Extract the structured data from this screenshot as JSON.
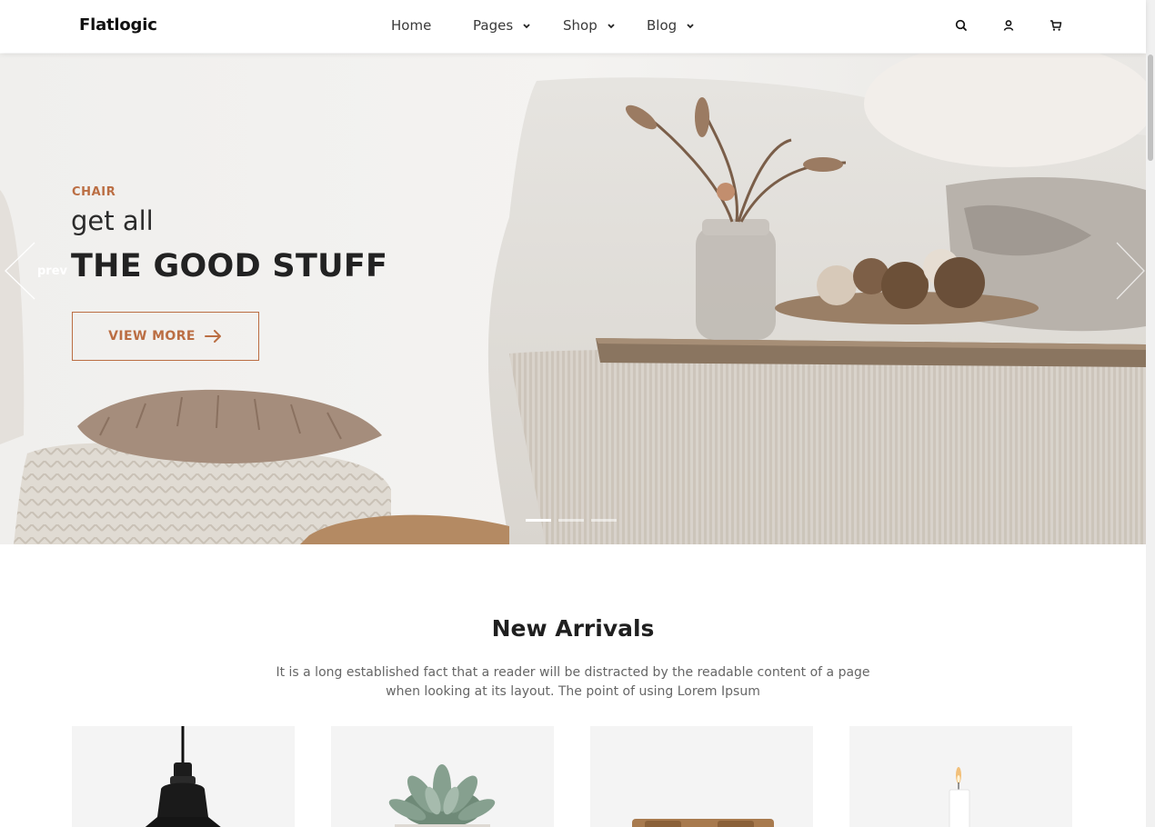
{
  "brand": {
    "logo": "Flatlogic"
  },
  "nav": {
    "items": [
      {
        "label": "Home",
        "has_dropdown": false
      },
      {
        "label": "Pages",
        "has_dropdown": true
      },
      {
        "label": "Shop",
        "has_dropdown": true
      },
      {
        "label": "Blog",
        "has_dropdown": true
      }
    ]
  },
  "header_icons": [
    "search-icon",
    "user-icon",
    "cart-icon"
  ],
  "hero": {
    "eyebrow": "CHAIR",
    "lead": "get all",
    "headline": "THE GOOD STUFF",
    "cta_label": "VIEW MORE",
    "prev_label": "prev",
    "slides_total": 3,
    "active_slide": 1
  },
  "arrivals": {
    "title": "New Arrivals",
    "subtitle": "It is a long established fact that a reader will be distracted by the readable content of a page when looking at its layout. The point of using Lorem Ipsum",
    "products": [
      {
        "icon": "pendant-lamp-image"
      },
      {
        "icon": "succulent-plant-image"
      },
      {
        "icon": "wooden-tray-image"
      },
      {
        "icon": "candle-image"
      }
    ]
  },
  "colors": {
    "accent": "#bb6e43",
    "text": "#1f1f1f",
    "muted": "#666666",
    "card_bg": "#f4f4f4"
  }
}
